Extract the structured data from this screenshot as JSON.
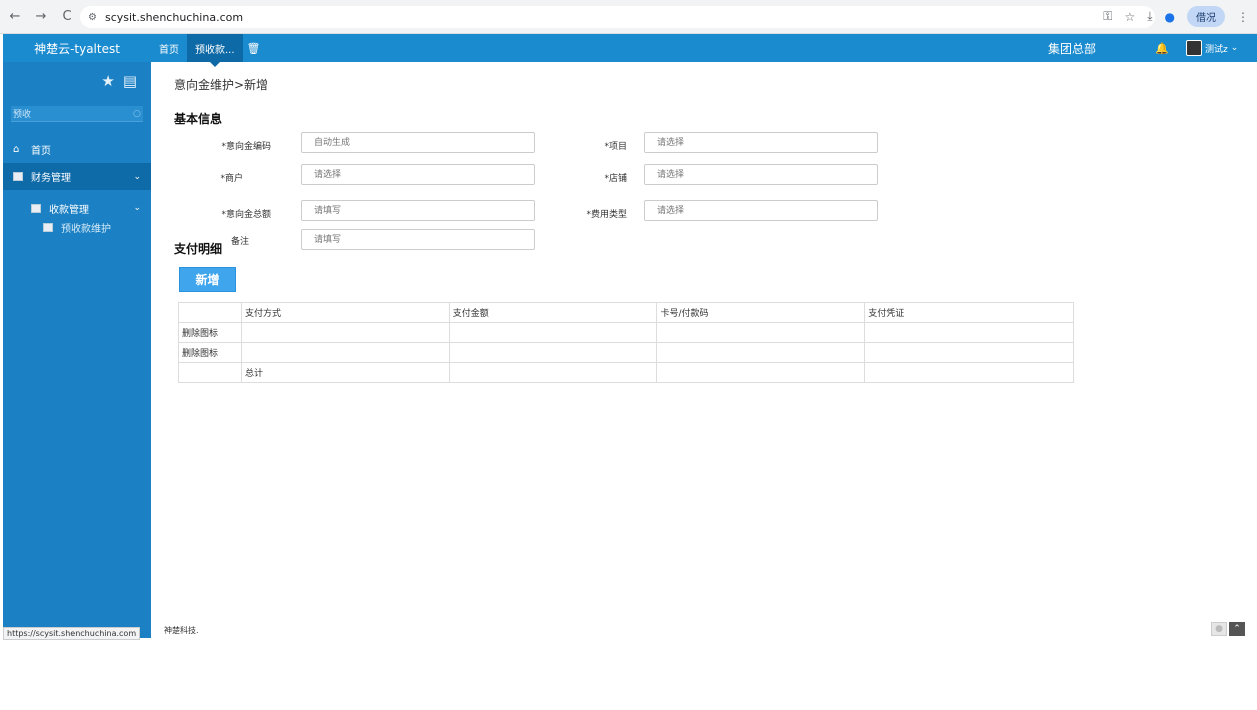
{
  "browser": {
    "url": "scysit.shenchuchina.com",
    "profile_label": "借况"
  },
  "header": {
    "brand": "神楚云-tyaltest",
    "tabs": [
      {
        "label": "首页"
      },
      {
        "label": "预收款..."
      }
    ],
    "org": "集团总部",
    "user": "测试z"
  },
  "sidebar": {
    "search_value": "预收",
    "items": {
      "home": "首页",
      "finance": "财务管理",
      "collect": "收款管理",
      "prepay": "预收款维护"
    }
  },
  "main": {
    "breadcrumb": "意向金维护>新增",
    "basic_title": "基本信息",
    "pay_title": "支付明细",
    "fields": {
      "code_label": "*意向金编码",
      "code_ph": "自动生成",
      "project_label": "*项目",
      "project_ph": "请选择",
      "merchant_label": "*商户",
      "merchant_ph": "请选择",
      "shop_label": "*店铺",
      "shop_ph": "请选择",
      "amount_label": "*意向金总额",
      "amount_ph": "请填写",
      "feetype_label": "*费用类型",
      "feetype_ph": "请选择",
      "remark_label": "备注",
      "remark_ph": "请填写"
    },
    "add_button": "新增",
    "table": {
      "headers": [
        "",
        "支付方式",
        "支付金额",
        "卡号/付款码",
        "支付凭证"
      ],
      "delete_label": "删除图标",
      "total_label": "总计"
    },
    "footer": "神楚科技.",
    "status_url": "https://scysit.shenchuchina.com"
  },
  "colors": {
    "header": "#1b8bcf",
    "sidebar": "#1b80c4",
    "active_tab": "#0e6aa6",
    "button": "#3fa5ed"
  },
  "icons": [
    "back-icon",
    "forward-icon",
    "reload-icon",
    "key-icon",
    "star-icon",
    "download-icon",
    "trash-icon",
    "bell-icon",
    "list-icon",
    "search-icon",
    "home-icon",
    "chevron-down-icon",
    "scroll-top-icon"
  ]
}
